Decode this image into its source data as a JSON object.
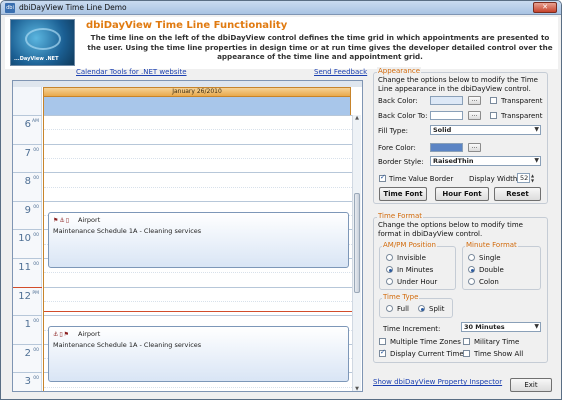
{
  "window": {
    "title": "dbiDayView Time Line Demo",
    "app_icon": "dbi",
    "close_label": "✕"
  },
  "header": {
    "title": "dbiDayView Time Line Functionality",
    "description": "The time line on the left of the dbiDayView control defines the time grid in which appointments are presented to the user.  Using the time line properties in design time or at run time gives the developer detailed control over the appearance of the time line and appointment grid.",
    "logo_text": "...DayView .NET"
  },
  "links": {
    "calendar_tools": "Calendar Tools for .NET website",
    "send_feedback": "Send Feedback",
    "inspector": "Show dbiDayView Property Inspector"
  },
  "dayview": {
    "date_header": "January 26/2010",
    "hours": [
      {
        "num": "6",
        "ampm": "AM"
      },
      {
        "num": "7",
        "ampm": "00"
      },
      {
        "num": "8",
        "ampm": "00"
      },
      {
        "num": "9",
        "ampm": "00"
      },
      {
        "num": "10",
        "ampm": "00"
      },
      {
        "num": "11",
        "ampm": "00"
      },
      {
        "num": "12",
        "ampm": "PM"
      },
      {
        "num": "1",
        "ampm": "00"
      },
      {
        "num": "2",
        "ampm": "00"
      },
      {
        "num": "3",
        "ampm": "00"
      }
    ],
    "appointments": [
      {
        "location": "Airport",
        "subject": "Maintenance Schedule 1A - Cleaning services",
        "icons": "⚑⚓▯"
      },
      {
        "location": "Airport",
        "subject": "Maintenance Schedule 1A - Cleaning services",
        "icons": "⚓▯⚑"
      }
    ]
  },
  "appearance": {
    "title": "Appearance",
    "desc": "Change the options below to modify the Time Line appearance in the dbiDayView control.",
    "back_color_label": "Back Color:",
    "back_color_to_label": "Back Color To:",
    "fill_type_label": "Fill Type:",
    "fore_color_label": "Fore Color:",
    "border_style_label": "Border Style:",
    "transparent_label": "Transparent",
    "dots": "...",
    "fill_type_value": "Solid",
    "border_style_value": "RaisedThin",
    "time_value_border_label": "Time Value Border",
    "display_width_label": "Display Width:",
    "display_width_value": "52",
    "time_font_btn": "Time Font",
    "hour_font_btn": "Hour Font",
    "reset_btn": "Reset",
    "colors": {
      "back": "#dde8f6",
      "back_to": "#ffffff",
      "fore": "#5b84c4"
    }
  },
  "time_format": {
    "title": "Time Format",
    "desc": "Change the options below to modify time format in dbiDayView control.",
    "ampm_title": "AM/PM Position",
    "ampm_options": [
      "Invisible",
      "In Minutes",
      "Under Hour"
    ],
    "minute_title": "Minute Format",
    "minute_options": [
      "Single",
      "Double",
      "Colon"
    ],
    "time_type_title": "Time Type",
    "time_type_options": [
      "Full",
      "Split"
    ],
    "increment_label": "Time Increment:",
    "increment_value": "30 Minutes",
    "multiple_tz": "Multiple Time Zones",
    "military_time": "Military Time",
    "display_current": "Display Current Time",
    "time_show_all": "Time Show All"
  },
  "exit_btn": "Exit"
}
